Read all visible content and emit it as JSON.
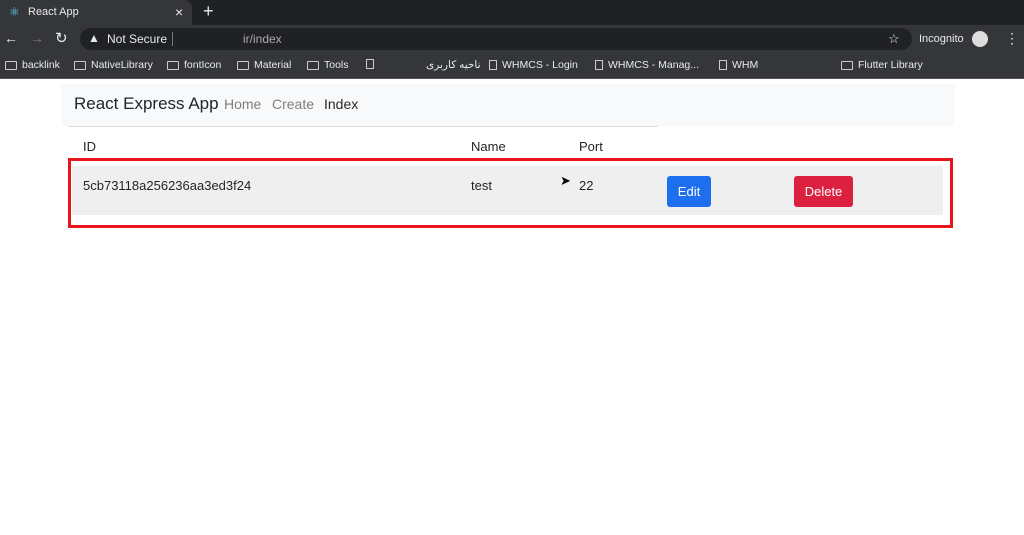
{
  "browser": {
    "tab_title": "React App",
    "close_tab": "×",
    "new_tab": "+",
    "security_label": "Not Secure",
    "url": "ir/index",
    "incognito_label": "Incognito",
    "bookmarks": [
      {
        "label": "backlink",
        "icon": "folder-icon"
      },
      {
        "label": "NativeLibrary",
        "icon": "folder-icon"
      },
      {
        "label": "fontIcon",
        "icon": "folder-icon"
      },
      {
        "label": "Material",
        "icon": "folder-icon"
      },
      {
        "label": "Tools",
        "icon": "folder-icon"
      },
      {
        "label": "",
        "icon": "page-icon"
      },
      {
        "label": "ناحیه کاربری",
        "icon": ""
      },
      {
        "label": "WHMCS - Login",
        "icon": "page-icon"
      },
      {
        "label": "WHMCS - Manag...",
        "icon": "page-icon"
      },
      {
        "label": "WHM",
        "icon": "page-icon"
      },
      {
        "label": "Flutter Library",
        "icon": "folder-icon"
      }
    ]
  },
  "navbar": {
    "brand": "React Express App",
    "links": [
      "Home",
      "Create",
      "Index"
    ]
  },
  "table": {
    "headers": [
      "ID",
      "Name",
      "Port"
    ],
    "rows": [
      {
        "id": "5cb73118a256236aa3ed3f24",
        "name": "test",
        "port": "22",
        "edit": "Edit",
        "delete": "Delete"
      }
    ]
  },
  "colors": {
    "primary": "#1e6ff0",
    "danger": "#dc2040",
    "highlight": "#e8141d"
  }
}
